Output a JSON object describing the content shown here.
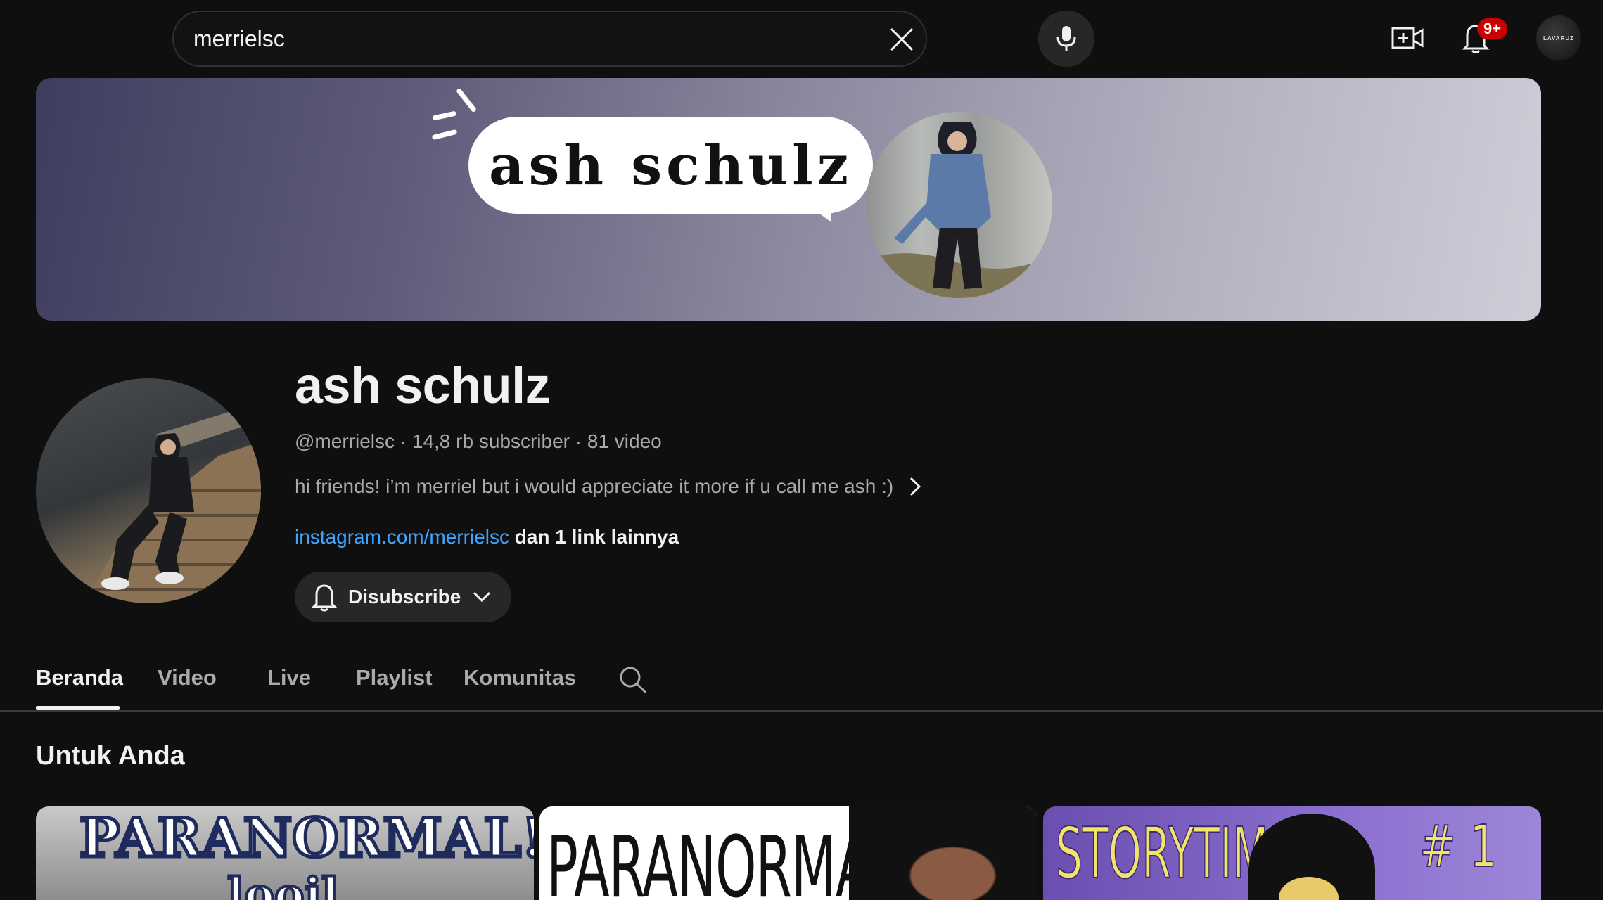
{
  "search": {
    "value": "merrielsc"
  },
  "header": {
    "notification_count": "9+",
    "account_label": "LAVARUZ"
  },
  "banner": {
    "bubble_text": "ash schulz"
  },
  "channel": {
    "name": "ash schulz",
    "handle": "@merrielsc",
    "subscribers": "14,8 rb subscriber",
    "videos": "81 video",
    "meta_sep": " · ",
    "description": "hi friends! i’m merriel but i would appreciate it more if u call me ash :)",
    "link": "instagram.com/merrielsc",
    "more_links": "dan 1 link lainnya",
    "subscribe_label": "Disubscribe"
  },
  "tabs": [
    {
      "label": "Beranda",
      "active": true
    },
    {
      "label": "Video",
      "active": false
    },
    {
      "label": "Live",
      "active": false
    },
    {
      "label": "Playlist",
      "active": false
    },
    {
      "label": "Komunitas",
      "active": false
    }
  ],
  "section": {
    "title": "Untuk Anda"
  },
  "thumbnails": [
    {
      "title_text": "PARANORMAL!",
      "sub_text": "looil",
      "colors": [
        "#1f2b5c",
        "#ffffff"
      ]
    },
    {
      "title_text": "PARANORMAL"
    },
    {
      "title_text": "STORYTIME!",
      "episode": "# 1",
      "accent": "#f2e46a"
    }
  ],
  "colors": {
    "background": "#0f0f0f",
    "link": "#3ea6ff",
    "badge": "#cc0000",
    "secondary_text": "#aaaaaa"
  }
}
